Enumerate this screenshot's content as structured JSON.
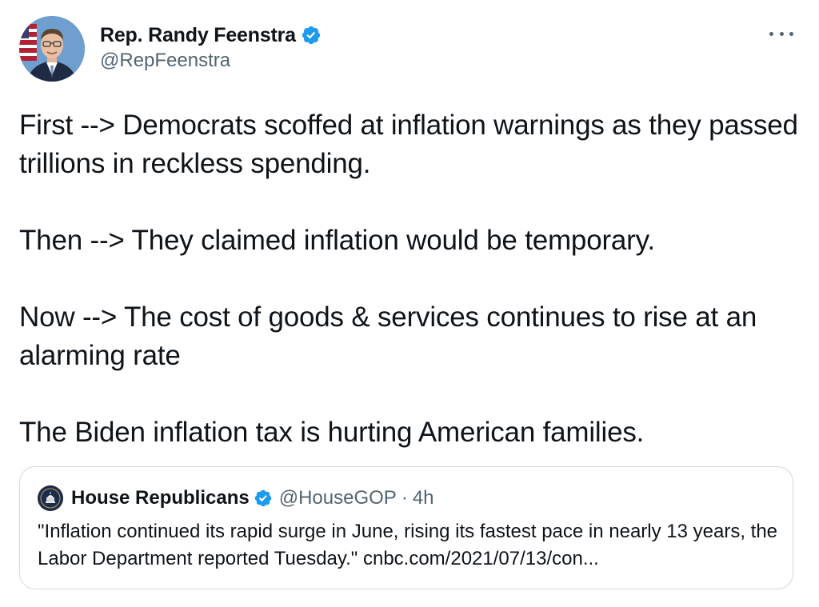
{
  "author": {
    "display_name": "Rep. Randy Feenstra",
    "handle": "@RepFeenstra",
    "verified": true
  },
  "more_menu": {
    "icon": "more-horizontal-icon"
  },
  "tweet": {
    "paragraphs": [
      "First --> Democrats scoffed at inflation warnings as they passed trillions in reckless spending.",
      "Then --> They claimed inflation would be temporary.",
      "Now --> The cost of goods & services continues to rise at an alarming rate",
      "The Biden inflation tax is hurting American families."
    ]
  },
  "quoted_tweet": {
    "display_name": "House Republicans",
    "handle": "@HouseGOP",
    "separator": "·",
    "time": "4h",
    "verified": true,
    "text": "\"Inflation continued its rapid surge in June, rising its fastest pace in nearly 13 years, the Labor Department reported Tuesday.\" cnbc.com/2021/07/13/con..."
  },
  "colors": {
    "text_primary": "#0f1419",
    "text_secondary": "#536471",
    "verified_blue": "#1d9bf0",
    "border": "#cfd9de"
  }
}
